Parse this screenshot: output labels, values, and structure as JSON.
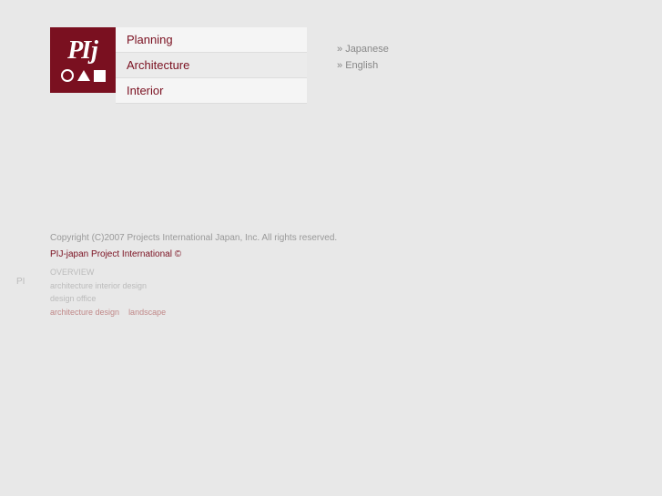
{
  "logo": {
    "pi_text": "PI",
    "j_text": "j",
    "alt": "PIJ Logo"
  },
  "nav": {
    "items": [
      {
        "label": "Planning",
        "id": "planning"
      },
      {
        "label": "Architecture",
        "id": "architecture"
      },
      {
        "label": "Interior",
        "id": "interior"
      }
    ]
  },
  "lang": {
    "japanese_label": "Japanese",
    "english_label": "English"
  },
  "footer": {
    "copyright": "Copyright (C)2007 Projects International Japan, Inc. All rights reserved.",
    "footer_link_label": "PIJ-japan Project International ©"
  },
  "pi_label": "PI",
  "small_text": {
    "line1": "OVERVIEW",
    "line2": "architecture interior design",
    "line3": "design office",
    "line4": "architecture design",
    "line5": "landscape"
  }
}
